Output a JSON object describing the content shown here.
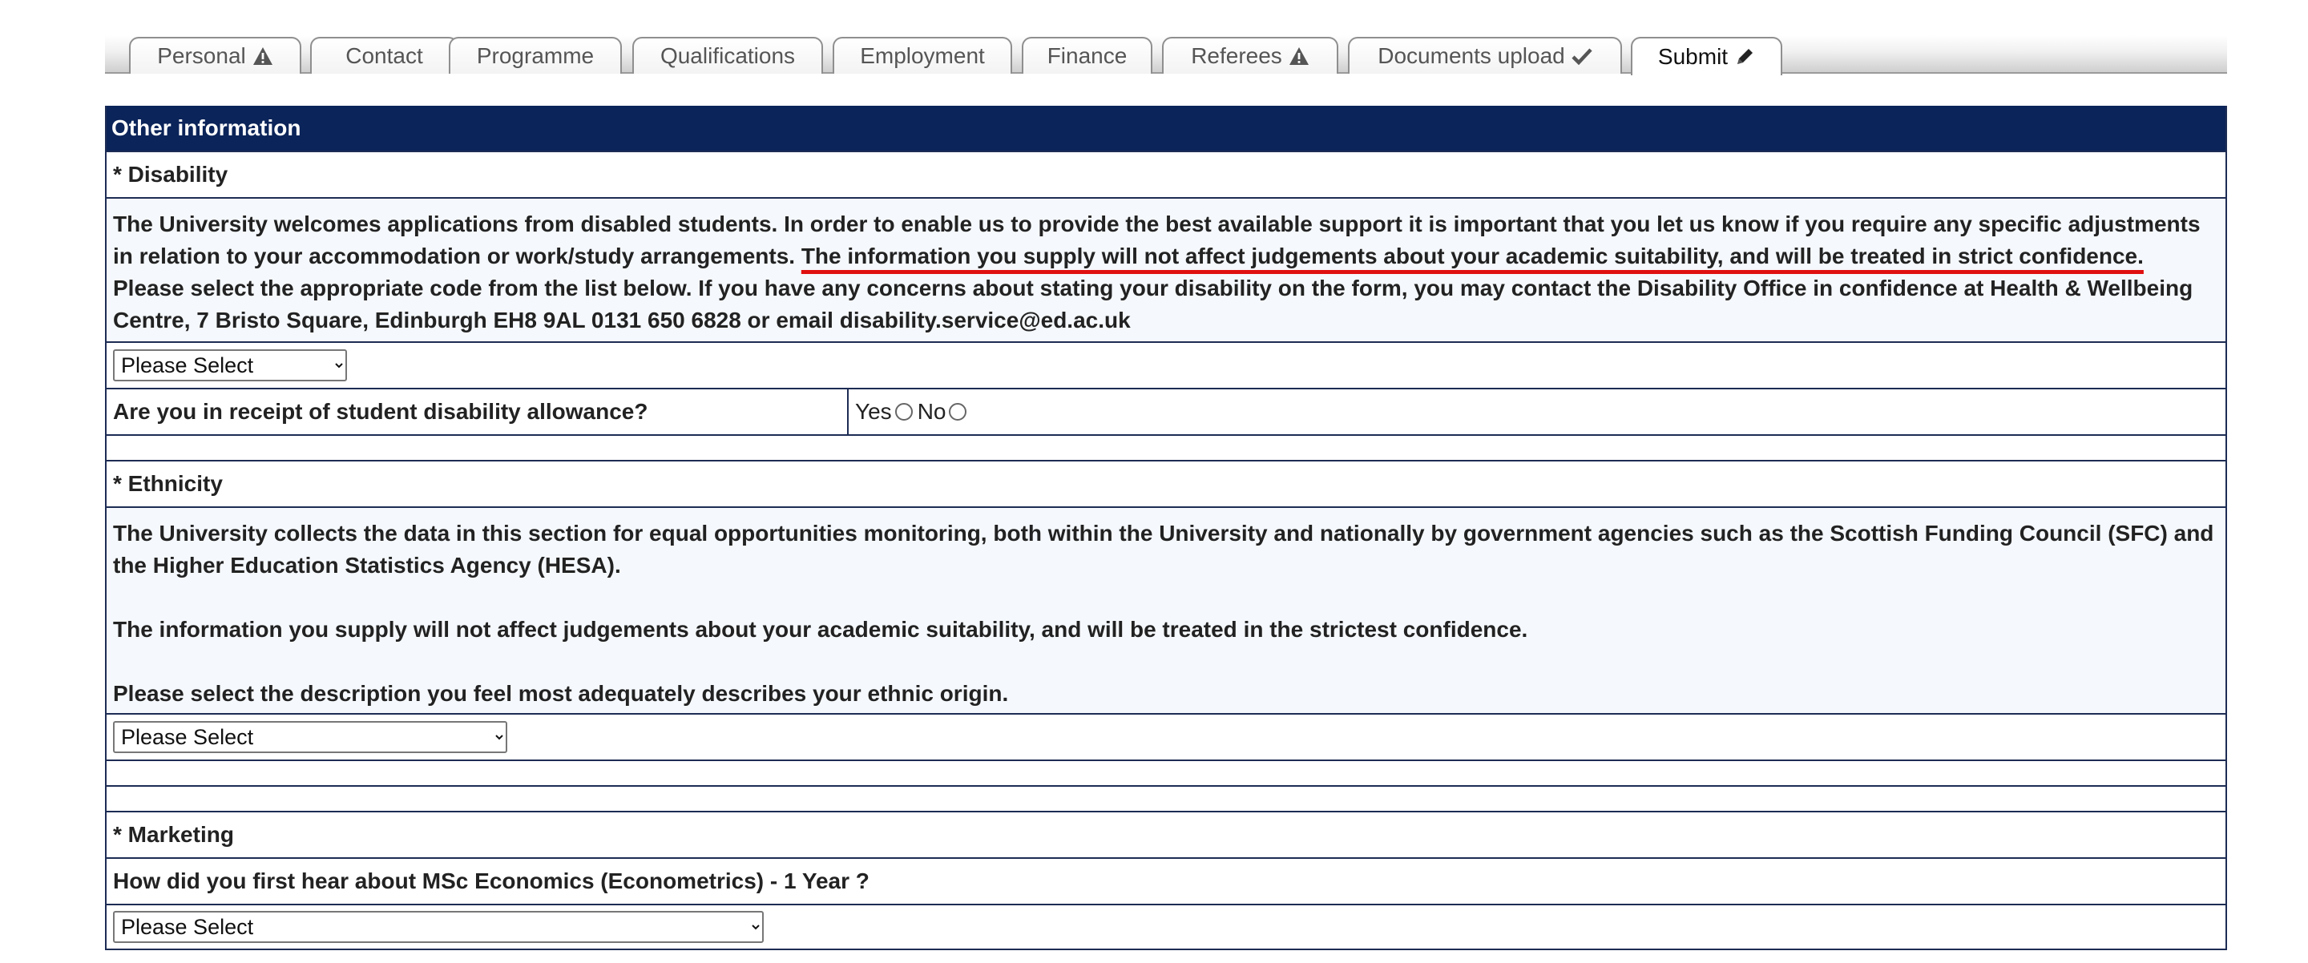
{
  "tabs": [
    {
      "label": "Personal",
      "icon": "warning-icon"
    },
    {
      "label": "Contact",
      "icon": ""
    },
    {
      "label": "Programme",
      "icon": ""
    },
    {
      "label": "Qualifications",
      "icon": ""
    },
    {
      "label": "Employment",
      "icon": ""
    },
    {
      "label": "Finance",
      "icon": ""
    },
    {
      "label": "Referees",
      "icon": "warning-icon"
    },
    {
      "label": "Documents upload",
      "icon": "checkmark-icon"
    },
    {
      "label": "Submit",
      "icon": "pencil-icon"
    }
  ],
  "active_tab": "Submit",
  "section": {
    "title": "Other information"
  },
  "disability": {
    "heading": "* Disability",
    "text_part1": "The University welcomes applications from disabled students. In order to enable us to provide the best available support it is important that you let us know if you require any specific adjustments in relation to your accommodation or work/study arrangements. ",
    "text_underlined": "The information you supply will not affect judgements about your academic suitability, and will be treated in strict confidence.",
    "text_part2": " Please select the appropriate code from the list below. If you have any concerns about stating your disability on the form, you may contact the Disability Office in confidence at Health & Wellbeing Centre, 7 Bristo Square, Edinburgh EH8 9AL 0131 650 6828 or email disability.service@ed.ac.uk",
    "select_value": "Please Select",
    "allowance_question": "Are you in receipt of student disability allowance?",
    "yes_label": "Yes",
    "no_label": "No"
  },
  "ethnicity": {
    "heading": "* Ethnicity",
    "para1": "The University collects the data in this section for equal opportunities monitoring, both within the University and nationally by government agencies such as the Scottish Funding Council (SFC) and the Higher Education Statistics Agency (HESA).",
    "para2": "The information you supply will not affect judgements about your academic suitability, and will be treated in the strictest confidence.",
    "para3": "Please select the description you feel most adequately describes your ethnic origin.",
    "select_value": "Please Select"
  },
  "marketing": {
    "heading": "* Marketing",
    "question": "How did you first hear about MSc Economics (Econometrics) - 1 Year ?",
    "select_value": "Please Select"
  },
  "colors": {
    "header_bg": "#0b2459",
    "border": "#1d2c54",
    "highlight_underline": "#e01010"
  }
}
